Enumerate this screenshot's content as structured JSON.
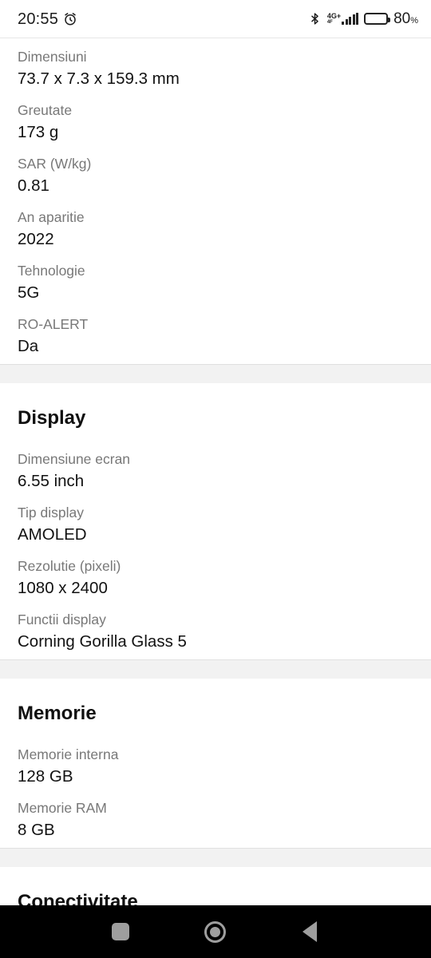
{
  "statusbar": {
    "time": "20:55",
    "alarm_icon": "alarm-clock-icon",
    "bluetooth_icon": "bluetooth-icon",
    "network_generation": "4G+",
    "network_sub": "4F",
    "signal_icon": "signal-bars-icon",
    "battery_icon": "battery-icon",
    "battery_percent": "80",
    "battery_percent_unit": "%"
  },
  "sections": [
    {
      "title": null,
      "rows": [
        {
          "label": "Dimensiuni",
          "value": "73.7 x 7.3 x 159.3 mm"
        },
        {
          "label": "Greutate",
          "value": "173 g"
        },
        {
          "label": "SAR (W/kg)",
          "value": "0.81"
        },
        {
          "label": "An aparitie",
          "value": "2022"
        },
        {
          "label": "Tehnologie",
          "value": "5G"
        },
        {
          "label": "RO-ALERT",
          "value": "Da"
        }
      ]
    },
    {
      "title": "Display",
      "rows": [
        {
          "label": "Dimensiune ecran",
          "value": "6.55 inch"
        },
        {
          "label": "Tip display",
          "value": "AMOLED"
        },
        {
          "label": "Rezolutie (pixeli)",
          "value": "1080 x 2400"
        },
        {
          "label": "Functii display",
          "value": "Corning Gorilla Glass 5"
        }
      ]
    },
    {
      "title": "Memorie",
      "rows": [
        {
          "label": "Memorie interna",
          "value": "128 GB"
        },
        {
          "label": "Memorie RAM",
          "value": "8 GB"
        }
      ]
    },
    {
      "title": "Conectivitate",
      "rows": []
    }
  ],
  "navbar": {
    "recents_icon": "square-recents-icon",
    "home_icon": "circle-home-icon",
    "back_icon": "triangle-back-icon"
  },
  "colors": {
    "label": "#787878",
    "value": "#121212",
    "divider": "#f2f2f2",
    "navbar_bg": "#000000",
    "nav_icon": "#9e9e9e"
  }
}
